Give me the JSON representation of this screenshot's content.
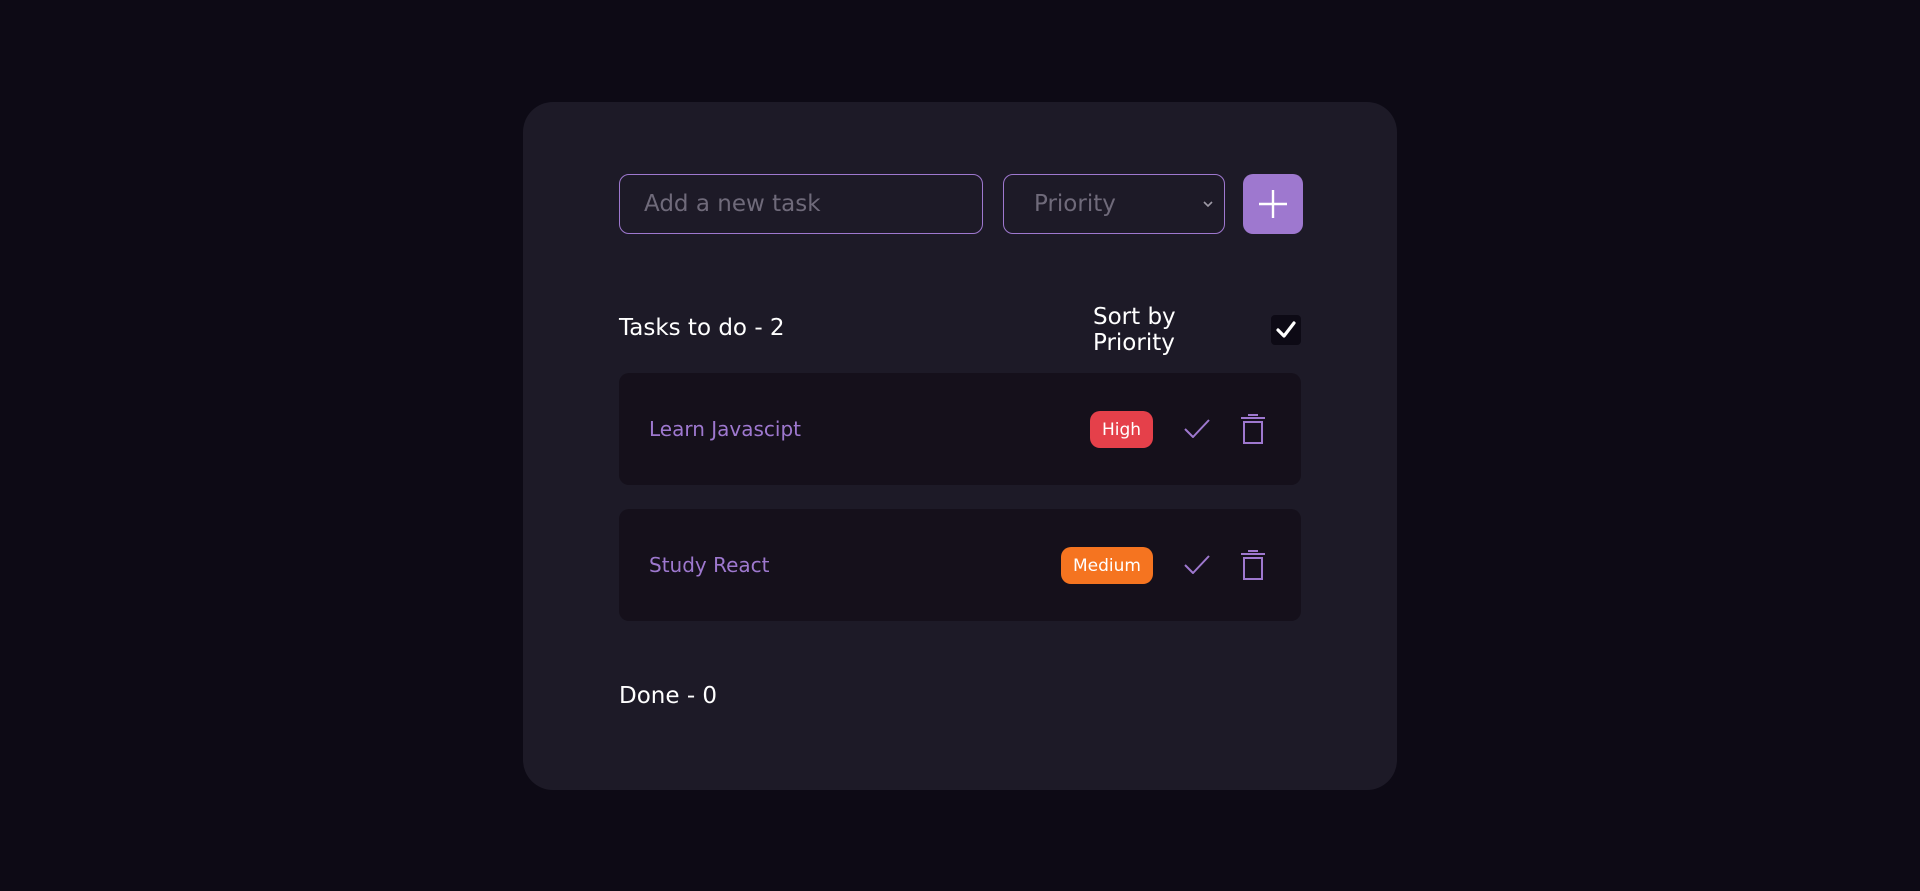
{
  "colors": {
    "background": "#0d0a15",
    "card": "#1d1a27",
    "accent": "#9e78cf",
    "task_background": "#15101b",
    "high": "#e5404a",
    "medium": "#f57420"
  },
  "form": {
    "task_placeholder": "Add a new task",
    "task_value": "",
    "priority_selected": "Priority",
    "add_icon": "plus-icon"
  },
  "tasks": {
    "title": "Tasks to do - 2",
    "sort_label": "Sort by Priority",
    "sort_checked": true,
    "items": [
      {
        "name": "Learn Javascipt",
        "priority": "High",
        "check_icon": "check-icon",
        "delete_icon": "trash-icon"
      },
      {
        "name": "Study React",
        "priority": "Medium",
        "check_icon": "check-icon",
        "delete_icon": "trash-icon"
      }
    ]
  },
  "done": {
    "title": "Done - 0"
  }
}
